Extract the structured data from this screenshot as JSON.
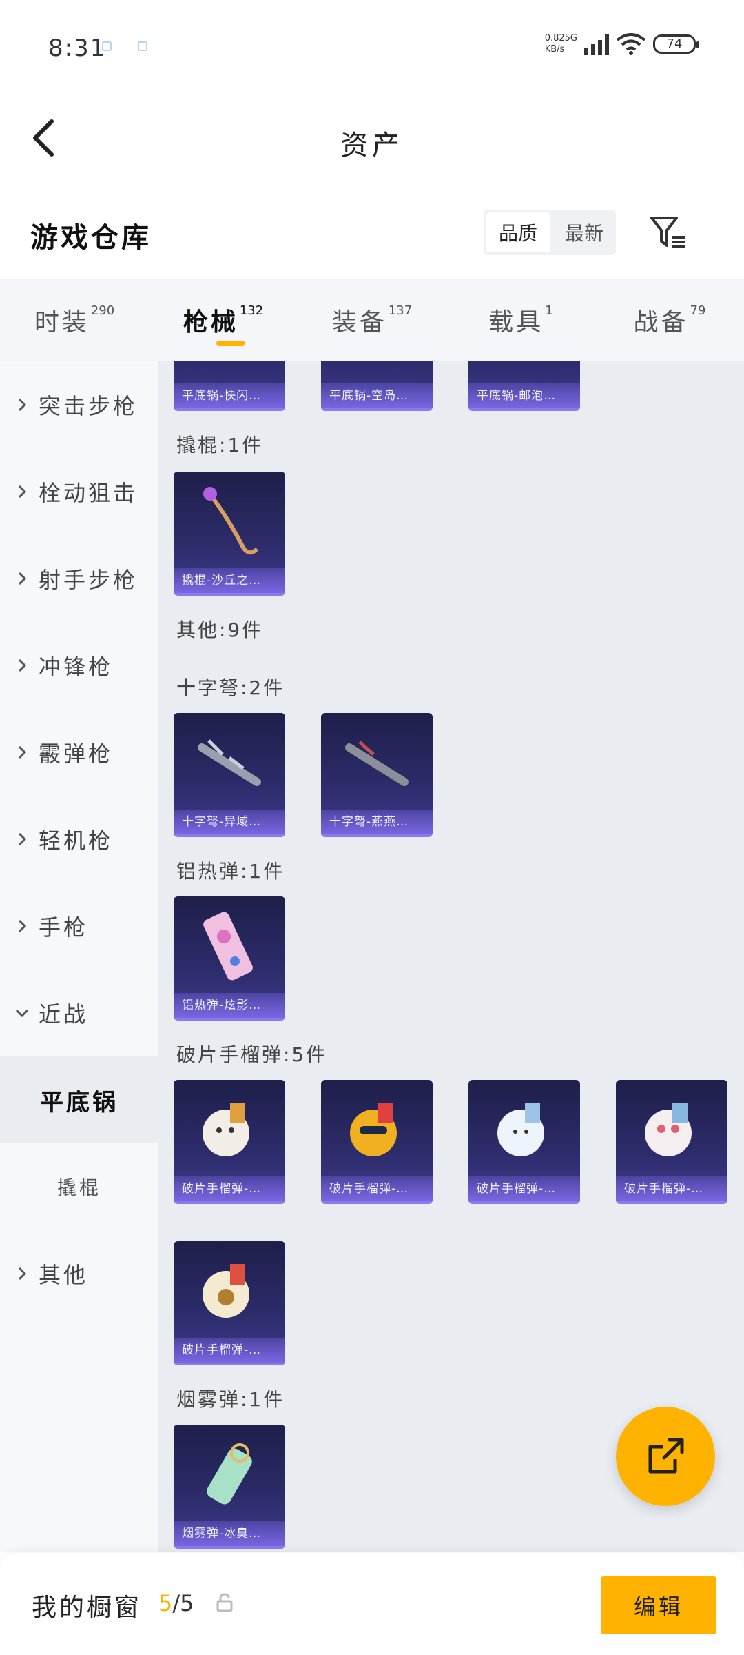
{
  "status_bar": {
    "time": "8:31",
    "net_speed_value": "0.82",
    "net_speed_unit": "5G",
    "net_speed_rate": "KB/s",
    "battery": "74"
  },
  "header": {
    "title": "资产"
  },
  "section": {
    "title": "游戏仓库",
    "sort_options": [
      "品质",
      "最新"
    ],
    "sort_active_index": 0
  },
  "tabs": [
    {
      "label": "时装",
      "count": "290"
    },
    {
      "label": "枪械",
      "count": "132"
    },
    {
      "label": "装备",
      "count": "137"
    },
    {
      "label": "载具",
      "count": "1"
    },
    {
      "label": "战备",
      "count": "79"
    }
  ],
  "active_tab_index": 1,
  "sidebar": {
    "items": [
      {
        "label": "突击步枪"
      },
      {
        "label": "栓动狙击"
      },
      {
        "label": "射手步枪"
      },
      {
        "label": "冲锋枪"
      },
      {
        "label": "霰弹枪"
      },
      {
        "label": "轻机枪"
      },
      {
        "label": "手枪"
      },
      {
        "label": "近战"
      },
      {
        "label": "平底锅"
      },
      {
        "label": "撬棍"
      },
      {
        "label": "其他"
      }
    ]
  },
  "content": {
    "top_partial_cards": [
      "平底锅-快闪…",
      "平底锅-空岛…",
      "平底锅-邮泡…"
    ],
    "groups": [
      {
        "title": "撬棍:1件",
        "cards": [
          "撬棍-沙丘之…"
        ]
      },
      {
        "title": "其他:9件",
        "cards": []
      },
      {
        "title": "十字弩:2件",
        "cards": [
          "十字弩-异域…",
          "十字弩-燕燕…"
        ]
      },
      {
        "title": "铝热弹:1件",
        "cards": [
          "铝热弹-炫影…"
        ]
      },
      {
        "title": "破片手榴弹:5件",
        "cards": [
          "破片手榴弹-…",
          "破片手榴弹-…",
          "破片手榴弹-…",
          "破片手榴弹-…",
          "破片手榴弹-…"
        ]
      },
      {
        "title": "烟雾弹:1件",
        "cards": [
          "烟雾弹-冰臭…"
        ]
      }
    ]
  },
  "bottom_bar": {
    "label": "我的橱窗",
    "current": "5",
    "total": "/5",
    "edit_label": "编辑"
  },
  "colors": {
    "accent": "#ffb300",
    "card_bg": "#2d2c6b",
    "content_bg": "#e9ecf1"
  }
}
